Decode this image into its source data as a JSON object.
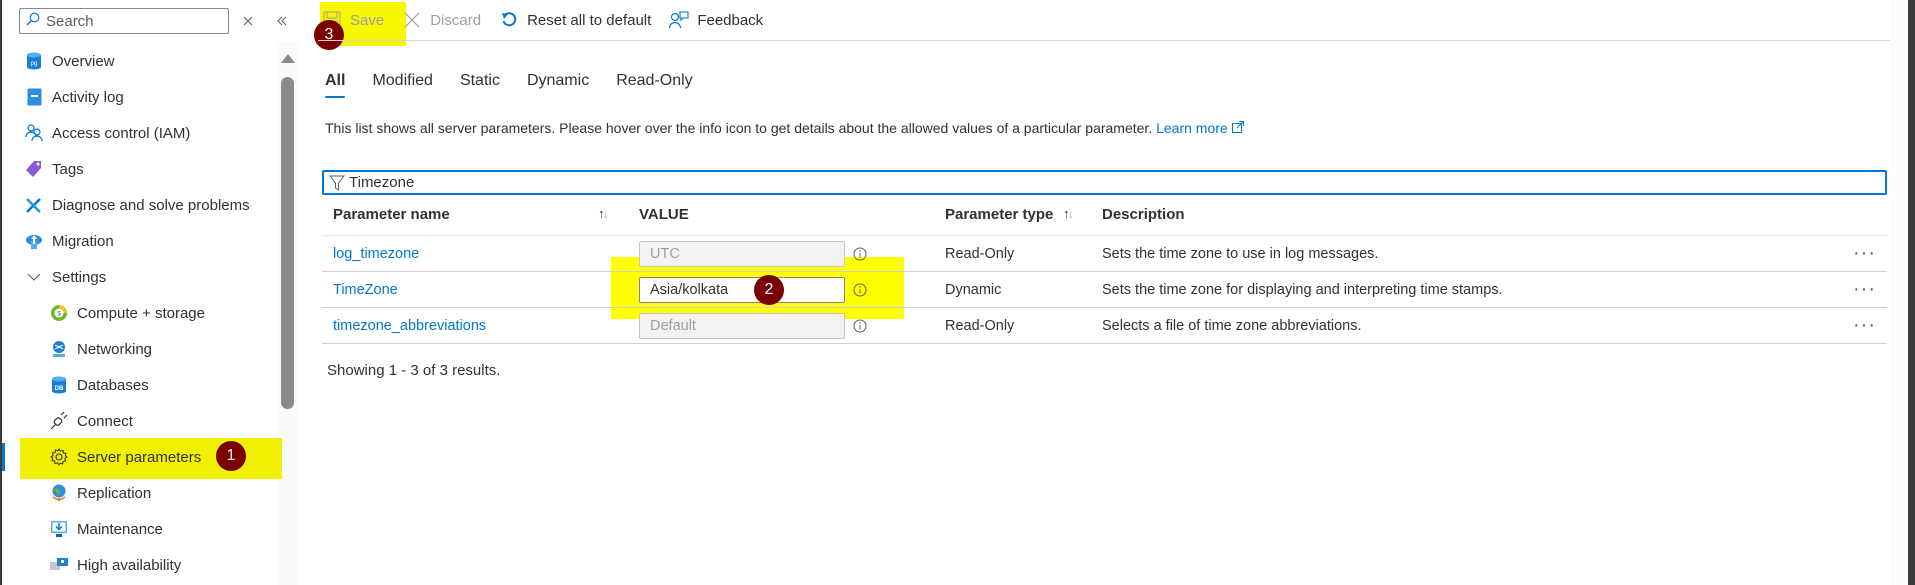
{
  "sidebar": {
    "search_placeholder": "Search",
    "items": [
      {
        "label": "Overview",
        "icon": "database-postgres-icon"
      },
      {
        "label": "Activity log",
        "icon": "activity-log-icon"
      },
      {
        "label": "Access control (IAM)",
        "icon": "people-icon"
      },
      {
        "label": "Tags",
        "icon": "tag-icon"
      },
      {
        "label": "Diagnose and solve problems",
        "icon": "wrench-icon"
      },
      {
        "label": "Migration",
        "icon": "cloud-upload-icon"
      },
      {
        "label": "Settings",
        "icon": "chevron-down-icon"
      },
      {
        "label": "Compute + storage",
        "icon": "compute-storage-icon"
      },
      {
        "label": "Networking",
        "icon": "networking-icon"
      },
      {
        "label": "Databases",
        "icon": "database-icon"
      },
      {
        "label": "Connect",
        "icon": "plug-icon"
      },
      {
        "label": "Server parameters",
        "icon": "gear-icon",
        "selected": true
      },
      {
        "label": "Replication",
        "icon": "globe-icon"
      },
      {
        "label": "Maintenance",
        "icon": "monitor-download-icon"
      },
      {
        "label": "High availability",
        "icon": "high-availability-icon"
      }
    ]
  },
  "toolbar": {
    "save_label": "Save",
    "discard_label": "Discard",
    "reset_label": "Reset all to default",
    "feedback_label": "Feedback"
  },
  "tabs": [
    {
      "label": "All",
      "active": true
    },
    {
      "label": "Modified"
    },
    {
      "label": "Static"
    },
    {
      "label": "Dynamic"
    },
    {
      "label": "Read-Only"
    }
  ],
  "info": {
    "text": "This list shows all server parameters. Please hover over the info icon to get details about the allowed values of a particular parameter. ",
    "link_label": "Learn more"
  },
  "filter": {
    "value": "Timezone"
  },
  "table": {
    "headers": {
      "name": "Parameter name",
      "value": "VALUE",
      "type": "Parameter type",
      "description": "Description"
    },
    "rows": [
      {
        "name": "log_timezone",
        "value": "UTC",
        "readonly": true,
        "type": "Read-Only",
        "description": "Sets the time zone to use in log messages."
      },
      {
        "name": "TimeZone",
        "value": "Asia/kolkata",
        "readonly": false,
        "type": "Dynamic",
        "description": "Sets the time zone for displaying and interpreting time stamps."
      },
      {
        "name": "timezone_abbreviations",
        "value": "Default",
        "readonly": true,
        "type": "Read-Only",
        "description": "Selects a file of time zone abbreviations."
      }
    ],
    "footer": "Showing 1 - 3 of 3 results."
  },
  "annotations": {
    "step1": "1",
    "step2": "2",
    "step3": "3",
    "highlight_color": "#ffff00",
    "badge_color": "#7a0000"
  },
  "colors": {
    "accent": "#0078d4"
  }
}
